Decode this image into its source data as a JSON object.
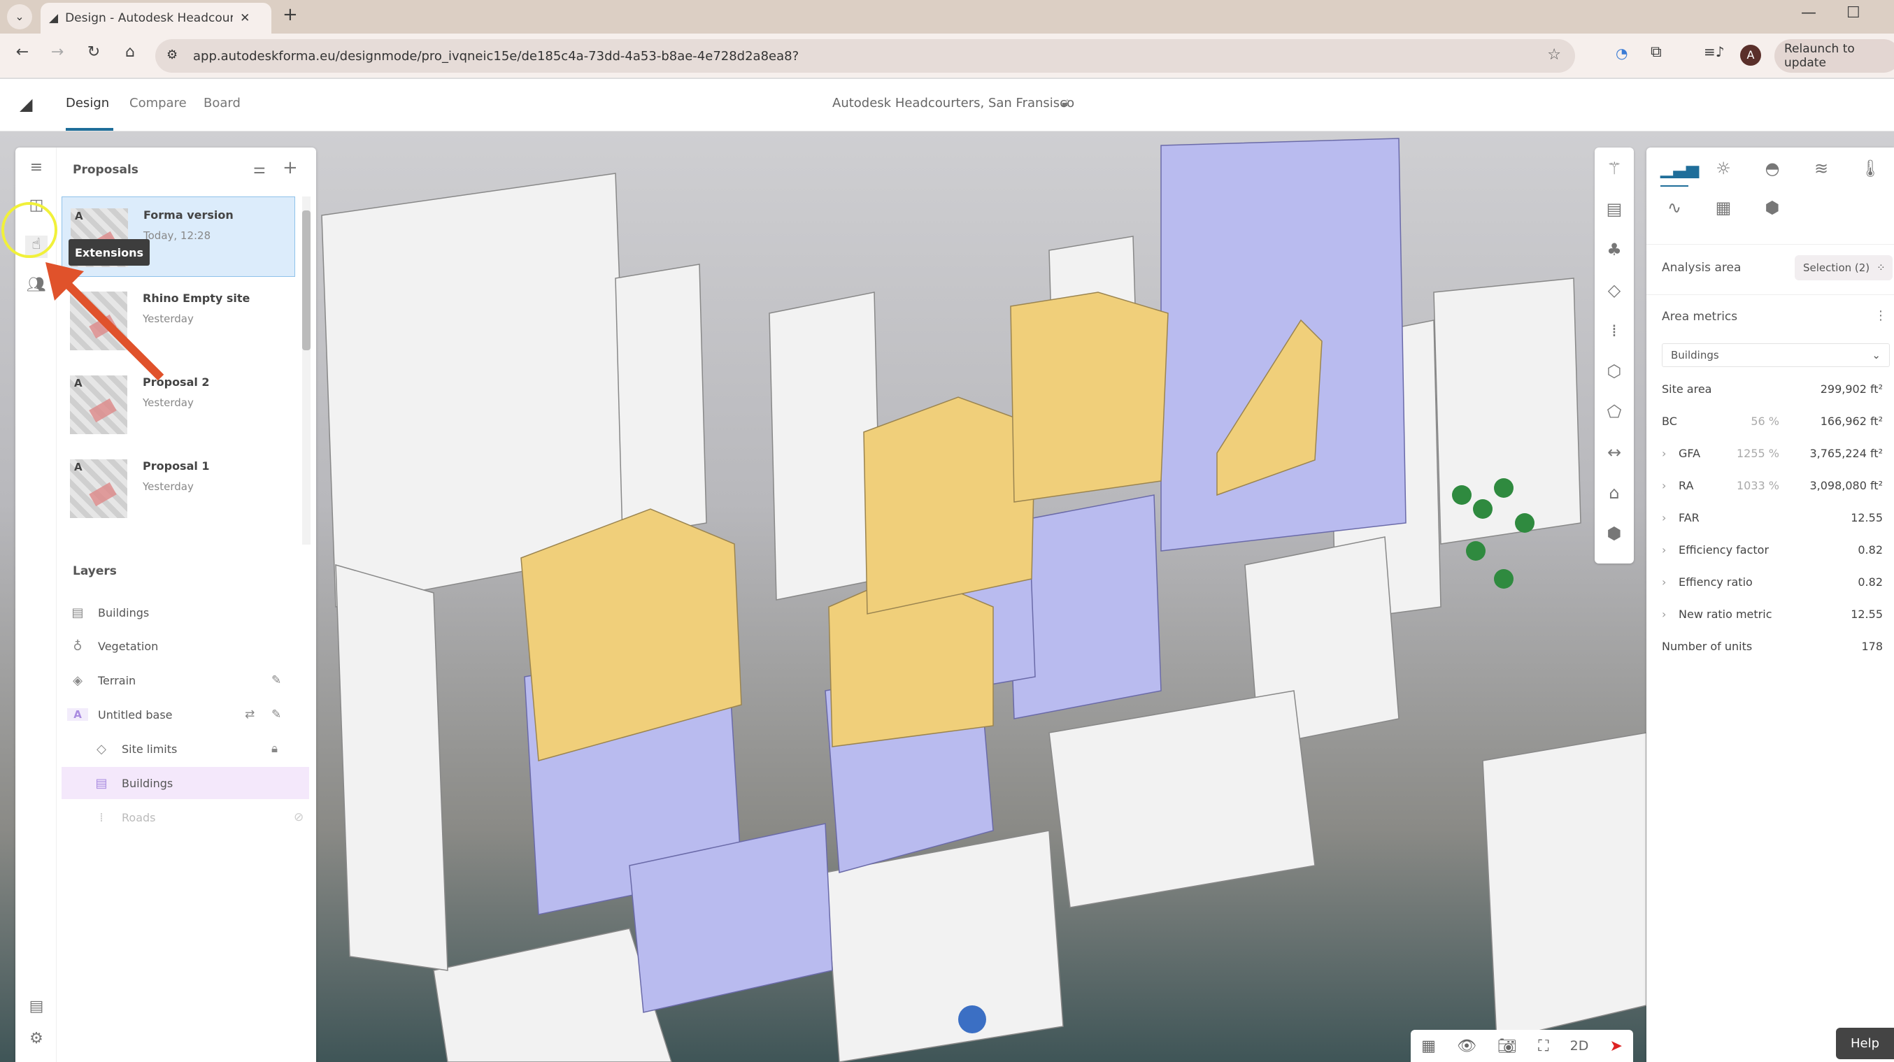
{
  "browser": {
    "tab_title": "Design - Autodesk Headcourters",
    "url": "app.autodeskforma.eu/designmode/pro_ivqneic15e/de185c4a-73dd-4a53-b8ae-4e728d2a8ea8?",
    "relaunch_label": "Relaunch to update",
    "profile_initial": "A"
  },
  "header": {
    "tabs": [
      {
        "label": "Design",
        "active": true
      },
      {
        "label": "Compare"
      },
      {
        "label": "Board"
      }
    ],
    "project_title": "Autodesk Headcourters, San Fransisco",
    "accent": "#1f6e9a"
  },
  "left_panel": {
    "proposals_title": "Proposals",
    "proposals": [
      {
        "name": "Forma version",
        "date": "Today, 12:28",
        "selected": true
      },
      {
        "name": "Rhino Empty site",
        "date": "Yesterday"
      },
      {
        "name": "Proposal 2",
        "date": "Yesterday"
      },
      {
        "name": "Proposal 1",
        "date": "Yesterday"
      }
    ],
    "layers_title": "Layers",
    "layers": [
      {
        "label": "Buildings"
      },
      {
        "label": "Vegetation"
      },
      {
        "label": "Terrain"
      },
      {
        "label": "Untitled base"
      },
      {
        "label": "Site limits"
      },
      {
        "label": "Buildings",
        "selected": true
      },
      {
        "label": "Roads",
        "hidden": true
      }
    ],
    "tooltip": "Extensions"
  },
  "right_panel": {
    "analysis_area_label": "Analysis area",
    "selection_label": "Selection (2)",
    "area_metrics_title": "Area metrics",
    "dropdown_value": "Buildings",
    "metrics": [
      {
        "label": "Site area",
        "value": "299,902 ft²"
      },
      {
        "label": "BC",
        "pct": "56 %",
        "value": "166,962 ft²"
      },
      {
        "label": "GFA",
        "pct": "1255 %",
        "value": "3,765,224 ft²",
        "expandable": true
      },
      {
        "label": "RA",
        "pct": "1033 %",
        "value": "3,098,080 ft²",
        "expandable": true
      },
      {
        "label": "FAR",
        "value": "12.55",
        "expandable": true
      },
      {
        "label": "Efficiency factor",
        "value": "0.82",
        "expandable": true
      },
      {
        "label": "Effiency ratio",
        "value": "0.82",
        "expandable": true
      },
      {
        "label": "New ratio metric",
        "value": "12.55",
        "expandable": true
      },
      {
        "label": "Number of units",
        "value": "178"
      }
    ]
  },
  "bottom_toolbar": {
    "mode_2d": "2D"
  },
  "help_label": "Help",
  "colors": {
    "proposed_massing_yellow": "#f0cf7a",
    "proposed_massing_blue": "#b9bbef",
    "selection_blue": "#dcecfb",
    "layer_highlight": "#f4e8fb",
    "annotation_arrow": "#e0522b",
    "cursor_highlight": "#f1f13a"
  }
}
